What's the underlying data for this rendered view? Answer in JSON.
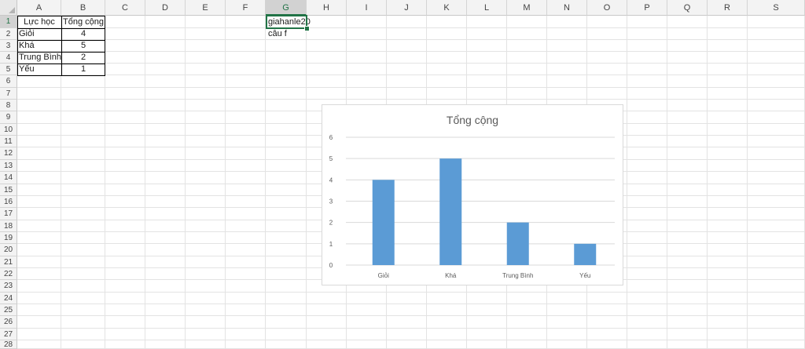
{
  "spreadsheet": {
    "columns": [
      "A",
      "B",
      "C",
      "D",
      "E",
      "F",
      "G",
      "H",
      "I",
      "J",
      "K",
      "L",
      "M",
      "N",
      "O",
      "P",
      "Q",
      "R",
      "S"
    ],
    "rows": [
      "1",
      "2",
      "3",
      "4",
      "5",
      "6",
      "7",
      "8",
      "9",
      "10",
      "11",
      "12",
      "13",
      "14",
      "15",
      "16",
      "17",
      "18",
      "19",
      "20",
      "21",
      "22",
      "23",
      "24",
      "25",
      "26",
      "27",
      "28"
    ],
    "selected_column": "G",
    "selected_row": "1",
    "table": {
      "headers": [
        "Lực học",
        "Tổng cộng"
      ],
      "rows": [
        {
          "label": "Giỏi",
          "value": "4"
        },
        {
          "label": "Khá",
          "value": "5"
        },
        {
          "label": "Trung Bình",
          "value": "2"
        },
        {
          "label": "Yếu",
          "value": "1"
        }
      ]
    },
    "notes": {
      "g1": "giahanle20",
      "g2": "câu f"
    }
  },
  "colors": {
    "accent": "#217346",
    "bar": "#5b9bd5",
    "gridline": "#d9d9d9"
  },
  "chart_data": {
    "type": "bar",
    "title": "Tổng cộng",
    "categories": [
      "Giỏi",
      "Khá",
      "Trung Bình",
      "Yếu"
    ],
    "series": [
      {
        "values": [
          4,
          5,
          2,
          1
        ]
      }
    ],
    "ylim": [
      0,
      6
    ],
    "yticks": [
      "0",
      "1",
      "2",
      "3",
      "4",
      "5",
      "6"
    ],
    "grid": true,
    "legend": "none"
  }
}
